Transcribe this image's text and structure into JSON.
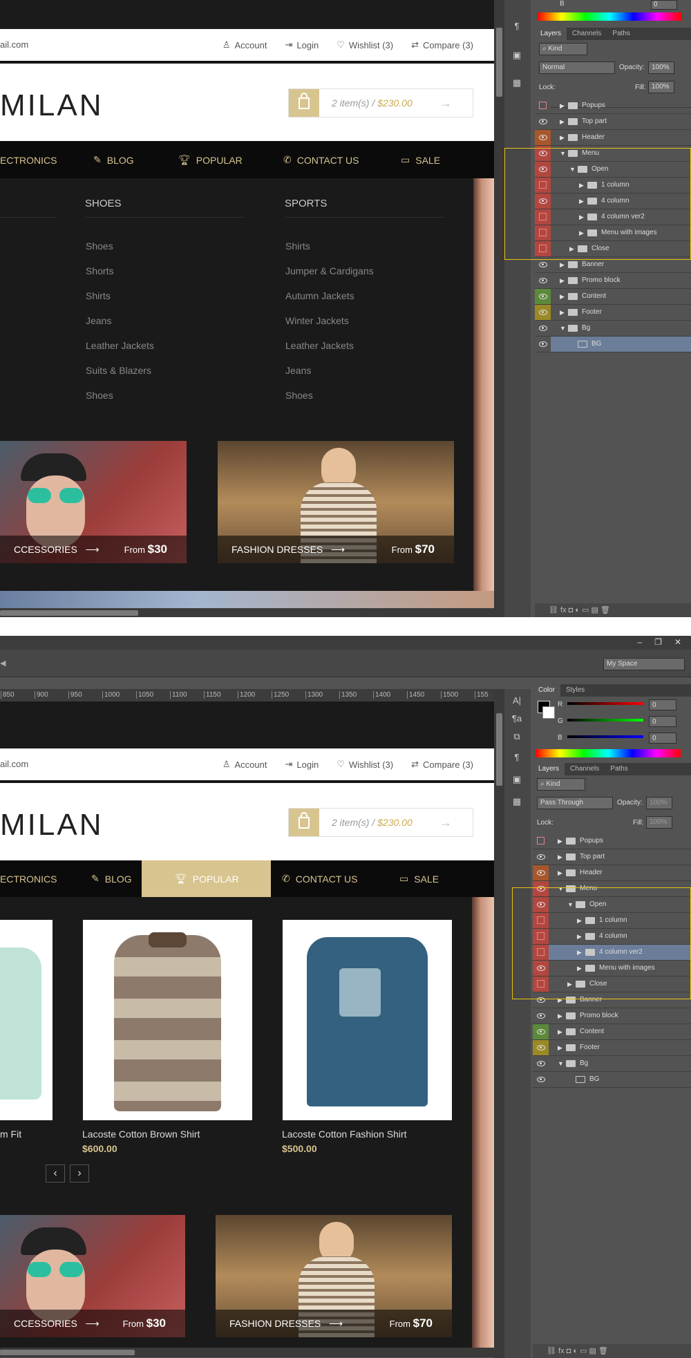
{
  "topbar": {
    "email_fragment": "ail.com",
    "email_fragment2": "ail.com",
    "account": "Account",
    "login": "Login",
    "wishlist": "Wishlist (3)",
    "compare": "Compare (3)"
  },
  "logo": "MILAN",
  "cart": {
    "items": "2 item(s) /",
    "price": "$230.00",
    "arrow": "→"
  },
  "nav": {
    "electronics": "ECTRONICS",
    "blog": "BLOG",
    "popular": "POPULAR",
    "contact": "CONTACT US",
    "sale": "SALE"
  },
  "mega": {
    "col1_title": "SHOES",
    "col1_items": [
      "Shoes",
      "Shorts",
      "Shirts",
      "Jeans",
      "Leather Jackets",
      "Suits & Blazers",
      "Shoes"
    ],
    "col2_title": "SPORTS",
    "col2_items": [
      "Shirts",
      "Jumper & Cardigans",
      "Autumn Jackets",
      "Winter Jackets",
      "Leather Jackets",
      "Jeans",
      "Shoes"
    ]
  },
  "banners": {
    "left_label": "CCESSORIES",
    "left_from": "From",
    "left_price": "$30",
    "right_label": "FASHION DRESSES",
    "right_from": "From",
    "right_price": "$70",
    "arrow": "⟶"
  },
  "products": [
    {
      "name": "m Fit",
      "price": ""
    },
    {
      "name": "Lacoste Cotton Brown Shirt",
      "price": "$600.00"
    },
    {
      "name": "Lacoste Cotton  Fashion Shirt",
      "price": "$500.00"
    }
  ],
  "pager": {
    "prev": "‹",
    "next": "›"
  },
  "ps": {
    "tabs": [
      "Layers",
      "Channels",
      "Paths"
    ],
    "tabs_color": [
      "Color",
      "Styles"
    ],
    "kind": "Kind",
    "blend_top": "Normal",
    "blend_bottom": "Pass Through",
    "opacity_label": "Opacity:",
    "opacity_top": "100%",
    "opacity_bottom": "100%",
    "lock_label": "Lock:",
    "fill_label": "Fill:",
    "fill_top": "100%",
    "fill_bottom": "100%",
    "workspace": "My Space",
    "channel_b": "B",
    "channel_zero": "0",
    "rgb_labels": [
      "R",
      "G",
      "B"
    ],
    "rgb_values": [
      "0",
      "0",
      "0"
    ],
    "ruler_ticks": [
      "850",
      "900",
      "950",
      "1000",
      "1050",
      "1100",
      "1150",
      "1200",
      "1250",
      "1300",
      "1350",
      "1400",
      "1450",
      "1500",
      "155"
    ],
    "layers_top": [
      "Popups",
      "Top part",
      "Header",
      "Menu",
      "Open",
      "1 column",
      "4 column",
      "4 column ver2",
      "Menu with images",
      "Close",
      "Banner",
      "Promo block",
      "Content",
      "Footer",
      "Bg",
      "BG"
    ],
    "layers_bottom": [
      "Popups",
      "Top part",
      "Header",
      "Menu",
      "Open",
      "1 column",
      "4 column",
      "4 column ver2",
      "Menu with images",
      "Close",
      "Banner",
      "Promo block",
      "Content",
      "Footer",
      "Bg",
      "BG"
    ]
  }
}
